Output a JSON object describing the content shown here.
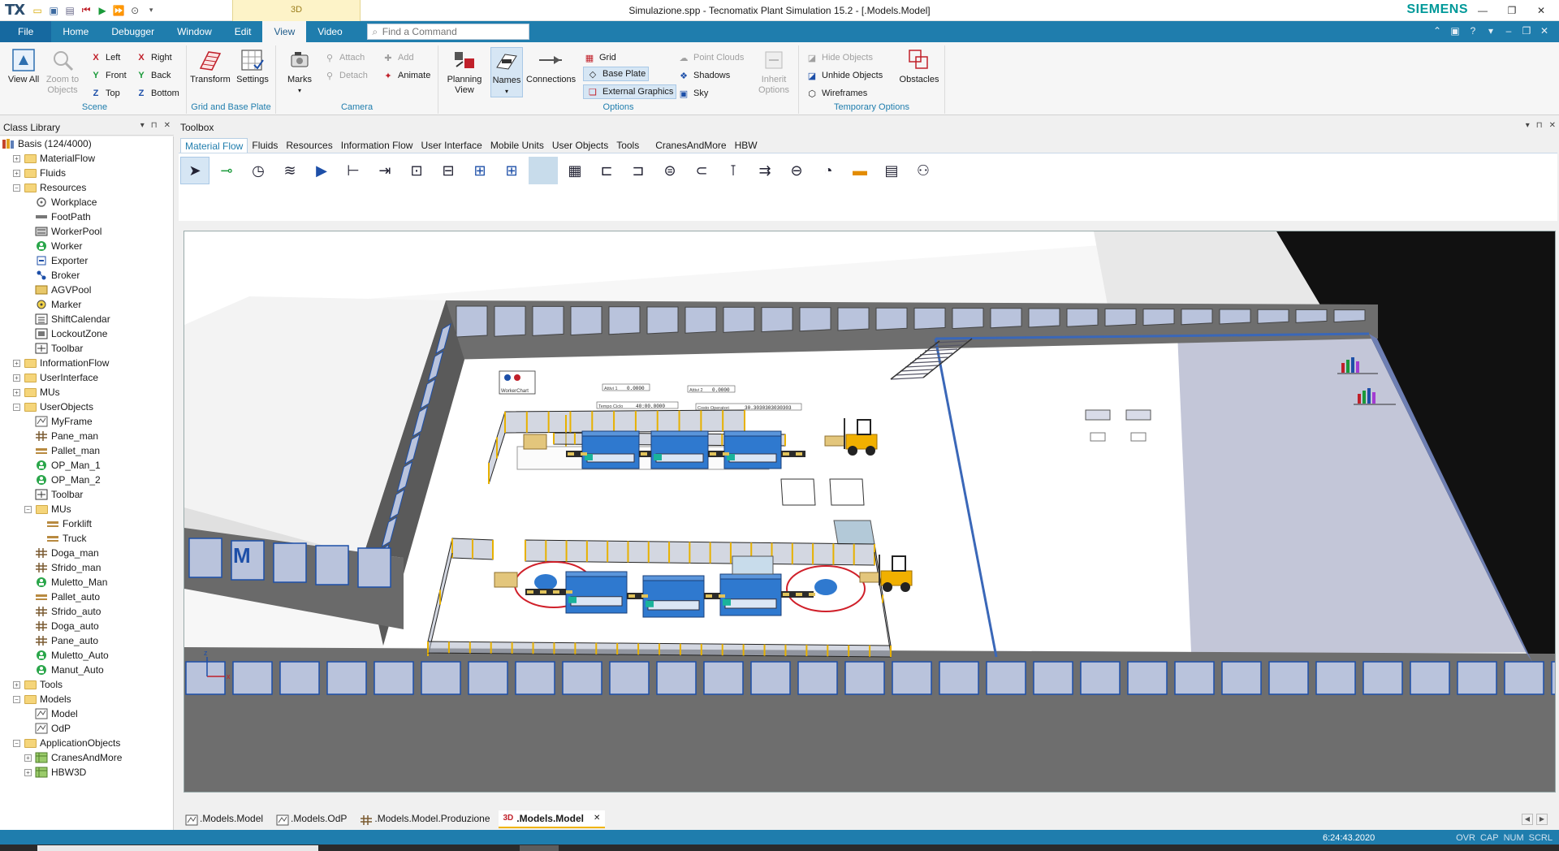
{
  "app": {
    "logo": "TX",
    "window_title": "Simulazione.spp - Tecnomatix Plant Simulation 15.2 - [.Models.Model]",
    "brand": "SIEMENS",
    "context_tab": "3D"
  },
  "menu_tabs": [
    "File",
    "Home",
    "Debugger",
    "Window",
    "Edit",
    "View",
    "Video"
  ],
  "command_search": {
    "placeholder": "Find a Command"
  },
  "ribbon": {
    "scene": {
      "label": "Scene",
      "view_all": "View All",
      "zoom_to_objects": "Zoom to Objects",
      "left": "Left",
      "right": "Right",
      "front": "Front",
      "back": "Back",
      "top": "Top",
      "bottom": "Bottom"
    },
    "grid": {
      "label": "Grid and Base Plate",
      "transform": "Transform",
      "settings": "Settings"
    },
    "camera": {
      "label": "Camera",
      "marks": "Marks",
      "attach": "Attach",
      "detach": "Detach",
      "add": "Add",
      "animate": "Animate"
    },
    "options": {
      "label": "Options",
      "planning_view": "Planning View",
      "names": "Names",
      "connections": "Connections",
      "grid": "Grid",
      "base_plate": "Base Plate",
      "external_graphics": "External Graphics",
      "point_clouds": "Point Clouds",
      "shadows": "Shadows",
      "sky": "Sky",
      "inherit_options": "Inherit Options"
    },
    "temporary": {
      "label": "Temporary Options",
      "hide_objects": "Hide Objects",
      "unhide_objects": "Unhide Objects",
      "wireframes": "Wireframes",
      "obstacles": "Obstacles"
    }
  },
  "class_library": {
    "title": "Class Library",
    "items": [
      {
        "label": "Basis (124/4000)",
        "indent": 0,
        "icon": "library"
      },
      {
        "label": "MaterialFlow",
        "indent": 1,
        "icon": "folder",
        "exp": "+"
      },
      {
        "label": "Fluids",
        "indent": 1,
        "icon": "folder",
        "exp": "+"
      },
      {
        "label": "Resources",
        "indent": 1,
        "icon": "folder",
        "exp": "-"
      },
      {
        "label": "Workplace",
        "indent": 2,
        "icon": "workplace"
      },
      {
        "label": "FootPath",
        "indent": 2,
        "icon": "footpath"
      },
      {
        "label": "WorkerPool",
        "indent": 2,
        "icon": "workerpool"
      },
      {
        "label": "Worker",
        "indent": 2,
        "icon": "worker"
      },
      {
        "label": "Exporter",
        "indent": 2,
        "icon": "exporter"
      },
      {
        "label": "Broker",
        "indent": 2,
        "icon": "broker"
      },
      {
        "label": "AGVPool",
        "indent": 2,
        "icon": "agvpool"
      },
      {
        "label": "Marker",
        "indent": 2,
        "icon": "marker"
      },
      {
        "label": "ShiftCalendar",
        "indent": 2,
        "icon": "calendar"
      },
      {
        "label": "LockoutZone",
        "indent": 2,
        "icon": "lockout"
      },
      {
        "label": "Toolbar",
        "indent": 2,
        "icon": "toolbar"
      },
      {
        "label": "InformationFlow",
        "indent": 1,
        "icon": "folder",
        "exp": "+"
      },
      {
        "label": "UserInterface",
        "indent": 1,
        "icon": "folder",
        "exp": "+"
      },
      {
        "label": "MUs",
        "indent": 1,
        "icon": "folder",
        "exp": "+"
      },
      {
        "label": "UserObjects",
        "indent": 1,
        "icon": "folder",
        "exp": "-"
      },
      {
        "label": "MyFrame",
        "indent": 2,
        "icon": "frame"
      },
      {
        "label": "Pane_man",
        "indent": 2,
        "icon": "grid"
      },
      {
        "label": "Pallet_man",
        "indent": 2,
        "icon": "pallet"
      },
      {
        "label": "OP_Man_1",
        "indent": 2,
        "icon": "worker"
      },
      {
        "label": "OP_Man_2",
        "indent": 2,
        "icon": "worker"
      },
      {
        "label": "Toolbar",
        "indent": 2,
        "icon": "toolbar"
      },
      {
        "label": "MUs",
        "indent": 2,
        "icon": "folder",
        "exp": "-"
      },
      {
        "label": "Forklift",
        "indent": 3,
        "icon": "pallet"
      },
      {
        "label": "Truck",
        "indent": 3,
        "icon": "pallet"
      },
      {
        "label": "Doga_man",
        "indent": 2,
        "icon": "grid"
      },
      {
        "label": "Sfrido_man",
        "indent": 2,
        "icon": "grid"
      },
      {
        "label": "Muletto_Man",
        "indent": 2,
        "icon": "worker"
      },
      {
        "label": "Pallet_auto",
        "indent": 2,
        "icon": "pallet"
      },
      {
        "label": "Sfrido_auto",
        "indent": 2,
        "icon": "grid"
      },
      {
        "label": "Doga_auto",
        "indent": 2,
        "icon": "grid"
      },
      {
        "label": "Pane_auto",
        "indent": 2,
        "icon": "grid"
      },
      {
        "label": "Muletto_Auto",
        "indent": 2,
        "icon": "worker"
      },
      {
        "label": "Manut_Auto",
        "indent": 2,
        "icon": "worker"
      },
      {
        "label": "Tools",
        "indent": 1,
        "icon": "folder",
        "exp": "+"
      },
      {
        "label": "Models",
        "indent": 1,
        "icon": "folder",
        "exp": "-"
      },
      {
        "label": "Model",
        "indent": 2,
        "icon": "frame"
      },
      {
        "label": "OdP",
        "indent": 2,
        "icon": "frame"
      },
      {
        "label": "ApplicationObjects",
        "indent": 1,
        "icon": "folder",
        "exp": "-"
      },
      {
        "label": "CranesAndMore",
        "indent": 2,
        "icon": "lib",
        "exp": "+"
      },
      {
        "label": "HBW3D",
        "indent": 2,
        "icon": "lib",
        "exp": "+"
      }
    ]
  },
  "toolbox": {
    "title": "Toolbox",
    "tabs": [
      "Material Flow",
      "Fluids",
      "Resources",
      "Information Flow",
      "User Interface",
      "Mobile Units",
      "User Objects",
      "Tools",
      "CranesAndMore",
      "HBW"
    ]
  },
  "viewport": {
    "labels": {
      "worker_chart": "WorkerChart",
      "attivi_1": "Attivi 1",
      "val_attivi_1": "0.0000",
      "attivi_2": "Attivi 2",
      "val_attivi_2": "0.0000",
      "tempo_ciclo": "Tempo Ciclo",
      "val_tempo": "40:00.0000",
      "costo_op": "Costo Operatori",
      "val_costo": "30.3030303030303"
    },
    "colors": {
      "floor": "#ffffff",
      "wall": "#6e6e6e",
      "window": "#b9c3dc",
      "machine": "#2f79cf",
      "fence": "#aeb7c8",
      "forklift": "#f1b000"
    }
  },
  "doc_tabs": [
    {
      "label": ".Models.Model",
      "active": false,
      "icon": "frame"
    },
    {
      "label": ".Models.OdP",
      "active": false,
      "icon": "frame"
    },
    {
      "label": ".Models.Model.Produzione",
      "active": false,
      "icon": "grid"
    },
    {
      "label": ".Models.Model",
      "active": true,
      "icon": "3D"
    }
  ],
  "status": {
    "time": "6:24:43.2020",
    "keys": [
      "OVR",
      "CAP",
      "NUM",
      "SCRL"
    ]
  }
}
